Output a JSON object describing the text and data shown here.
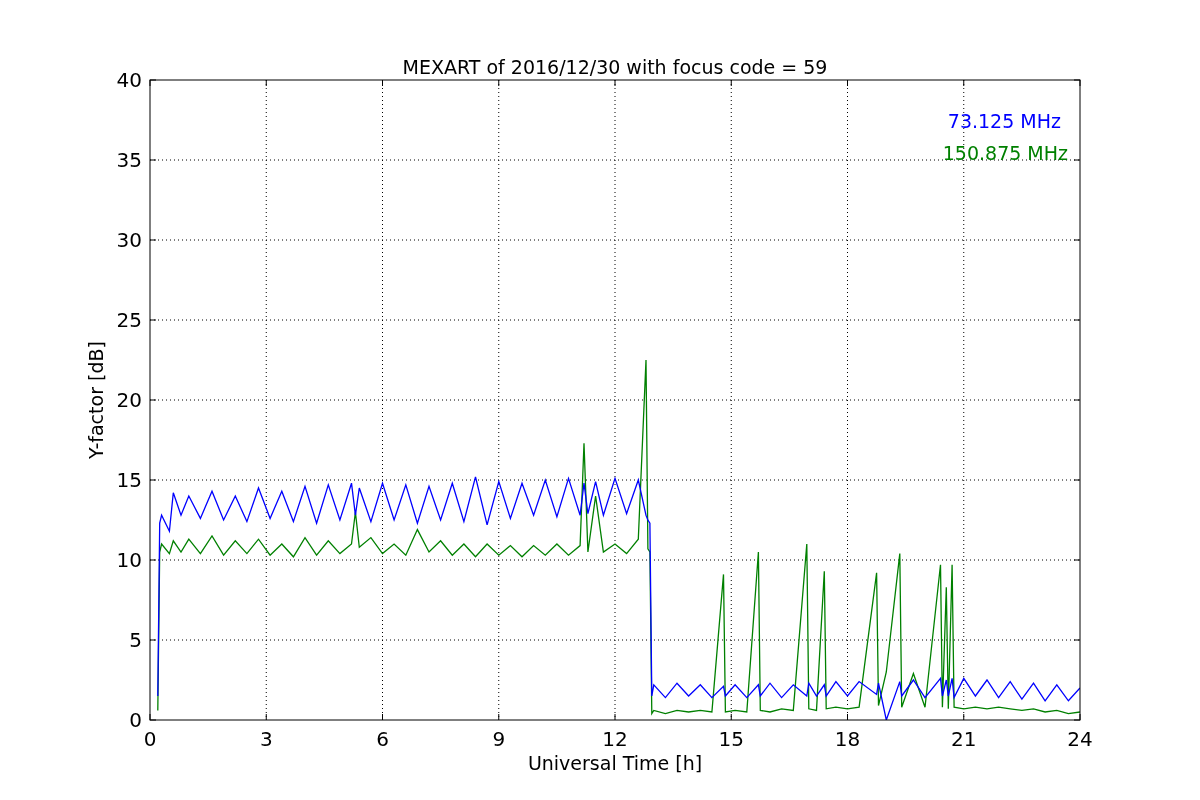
{
  "chart_data": {
    "type": "line",
    "grid": true,
    "title": "MEXART of 2016/12/30 with focus code = 59",
    "xlabel": "Universal Time [h]",
    "ylabel": "Y-factor [dB]",
    "xlim": [
      0,
      24
    ],
    "ylim": [
      0,
      40
    ],
    "xticks": [
      0,
      3,
      6,
      9,
      12,
      15,
      18,
      21,
      24
    ],
    "yticks": [
      0,
      5,
      10,
      15,
      20,
      25,
      30,
      35,
      40
    ],
    "x": [
      0.2,
      0.25,
      0.3,
      0.5,
      0.6,
      0.8,
      1.0,
      1.3,
      1.6,
      1.9,
      2.2,
      2.5,
      2.8,
      3.1,
      3.4,
      3.7,
      4.0,
      4.3,
      4.6,
      4.9,
      5.2,
      5.3,
      5.4,
      5.7,
      6.0,
      6.3,
      6.6,
      6.9,
      7.2,
      7.5,
      7.8,
      8.1,
      8.4,
      8.7,
      9.0,
      9.3,
      9.6,
      9.9,
      10.2,
      10.5,
      10.8,
      11.1,
      11.2,
      11.3,
      11.5,
      11.7,
      12.0,
      12.3,
      12.6,
      12.8,
      12.85,
      12.9,
      12.95,
      13.0,
      13.3,
      13.6,
      13.9,
      14.2,
      14.5,
      14.8,
      14.85,
      15.1,
      15.4,
      15.7,
      15.75,
      16.0,
      16.3,
      16.6,
      16.95,
      17.0,
      17.2,
      17.4,
      17.45,
      17.7,
      18.0,
      18.3,
      18.75,
      18.8,
      19.0,
      19.35,
      19.4,
      19.7,
      20.0,
      20.4,
      20.45,
      20.55,
      20.6,
      20.7,
      20.75,
      21.0,
      21.3,
      21.6,
      21.9,
      22.2,
      22.5,
      22.8,
      23.1,
      23.4,
      23.7,
      24.0
    ],
    "series": [
      {
        "name": "73.125 MHz",
        "color": "#0000ff",
        "values": [
          1.5,
          12.3,
          12.8,
          11.8,
          14.2,
          12.8,
          14.0,
          12.6,
          14.3,
          12.5,
          14.0,
          12.4,
          14.5,
          12.6,
          14.3,
          12.4,
          14.6,
          12.3,
          14.7,
          12.5,
          14.8,
          12.8,
          14.5,
          12.4,
          14.8,
          12.5,
          14.7,
          12.3,
          14.6,
          12.5,
          14.8,
          12.4,
          15.2,
          12.2,
          14.9,
          12.6,
          14.8,
          12.8,
          15.0,
          12.7,
          15.1,
          12.8,
          14.8,
          12.9,
          14.9,
          12.8,
          15.1,
          12.9,
          15.0,
          12.8,
          12.5,
          12.3,
          1.5,
          2.2,
          1.4,
          2.3,
          1.5,
          2.2,
          1.4,
          2.1,
          1.5,
          2.2,
          1.4,
          2.2,
          1.5,
          2.3,
          1.4,
          2.2,
          1.5,
          2.3,
          1.5,
          2.2,
          1.5,
          2.4,
          1.5,
          2.4,
          1.6,
          2.3,
          0.0,
          2.4,
          1.5,
          2.5,
          1.4,
          2.6,
          1.5,
          2.5,
          1.5,
          2.6,
          1.4,
          2.6,
          1.5,
          2.5,
          1.4,
          2.4,
          1.3,
          2.3,
          1.2,
          2.2,
          1.2,
          2.0
        ]
      },
      {
        "name": "150.875 MHz",
        "color": "#008000",
        "values": [
          0.6,
          10.5,
          11.0,
          10.4,
          11.2,
          10.5,
          11.3,
          10.4,
          11.5,
          10.3,
          11.2,
          10.4,
          11.3,
          10.3,
          11.0,
          10.2,
          11.4,
          10.3,
          11.2,
          10.4,
          11.0,
          13.0,
          10.8,
          11.4,
          10.4,
          11.0,
          10.3,
          11.9,
          10.5,
          11.2,
          10.3,
          11.0,
          10.2,
          11.0,
          10.3,
          10.9,
          10.2,
          10.9,
          10.3,
          11.0,
          10.3,
          10.9,
          17.3,
          10.5,
          14.0,
          10.5,
          11.0,
          10.4,
          11.3,
          22.5,
          10.7,
          10.5,
          0.4,
          0.6,
          0.4,
          0.6,
          0.5,
          0.6,
          0.5,
          9.1,
          0.5,
          0.6,
          0.5,
          10.5,
          0.6,
          0.5,
          0.7,
          0.6,
          11.0,
          0.7,
          0.6,
          9.3,
          0.7,
          0.8,
          0.7,
          0.8,
          9.2,
          0.9,
          3.0,
          10.4,
          0.8,
          2.9,
          0.8,
          9.7,
          0.8,
          8.3,
          0.7,
          9.7,
          0.8,
          0.7,
          0.8,
          0.7,
          0.8,
          0.7,
          0.6,
          0.7,
          0.5,
          0.6,
          0.4,
          0.5
        ]
      }
    ]
  }
}
